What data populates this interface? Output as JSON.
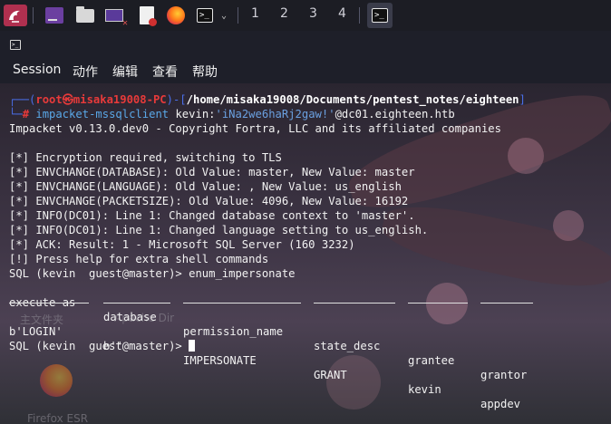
{
  "taskbar": {
    "icons": [
      "kali-menu-icon",
      "workspace-window-icon",
      "file-manager-icon",
      "desktop-icon",
      "text-editor-icon",
      "firefox-icon",
      "terminal-icon",
      "dropdown-icon"
    ],
    "workspaces": [
      "1",
      "2",
      "3",
      "4"
    ]
  },
  "window": {
    "menu": [
      "Session",
      "动作",
      "编辑",
      "查看",
      "帮助"
    ]
  },
  "terminal": {
    "prompt_user": "root㉿misaka19008-PC",
    "prompt_path": "/home/misaka19008/Documents/pentest_notes/eighteen",
    "prompt_symbol": "#",
    "cmd_name": "impacket-mssqlclient",
    "cmd_user": "kevin:",
    "cmd_pass": "'iNa2we6haRj2gaw!'",
    "cmd_host": "@dc01.eighteen.htb",
    "banner": "Impacket v0.13.0.dev0 - Copyright Fortra, LLC and its affiliated companies",
    "log": [
      "[*] Encryption required, switching to TLS",
      "[*] ENVCHANGE(DATABASE): Old Value: master, New Value: master",
      "[*] ENVCHANGE(LANGUAGE): Old Value: , New Value: us_english",
      "[*] ENVCHANGE(PACKETSIZE): Old Value: 4096, New Value: 16192",
      "[*] INFO(DC01): Line 1: Changed database context to 'master'.",
      "[*] INFO(DC01): Line 1: Changed language setting to us_english.",
      "[*] ACK: Result: 1 - Microsoft SQL Server (160 3232)",
      "[!] Press help for extra shell commands"
    ],
    "sql_cmd": "SQL (kevin  guest@master)> enum_impersonate",
    "table": {
      "headers": [
        "execute as",
        "database",
        "permission_name",
        "state_desc",
        "grantee",
        "grantor"
      ],
      "row": [
        "b'LOGIN'",
        "b''",
        "IMPERSONATE",
        "GRANT",
        "kevin",
        "appdev"
      ]
    },
    "sql_prompt": "SQL (kevin  guest@master)> "
  },
  "desktop_bg": {
    "labels": [
      "主文件夹",
      "Apache Dir",
      "Firefox ESR"
    ]
  }
}
